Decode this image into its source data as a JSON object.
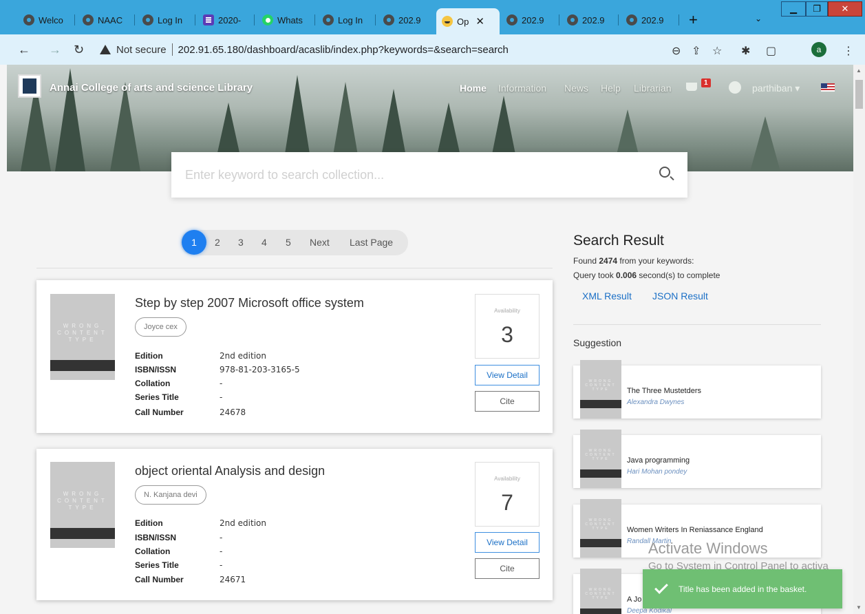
{
  "browser": {
    "tabs": [
      {
        "label": "Welco",
        "icon": "globe-icon"
      },
      {
        "label": "NAAC",
        "icon": "globe-icon"
      },
      {
        "label": "Log In",
        "icon": "globe-icon"
      },
      {
        "label": "2020-",
        "icon": "forms-icon"
      },
      {
        "label": "Whats",
        "icon": "whatsapp-icon"
      },
      {
        "label": "Log In",
        "icon": "globe-icon"
      },
      {
        "label": "202.9",
        "icon": "globe-icon"
      },
      {
        "label": "Op",
        "icon": "smile-icon",
        "active": true
      },
      {
        "label": "202.9",
        "icon": "globe-icon"
      },
      {
        "label": "202.9",
        "icon": "globe-icon"
      },
      {
        "label": "202.9",
        "icon": "globe-icon"
      }
    ],
    "new_tab": "+",
    "not_secure": "Not secure",
    "url": "202.91.65.180/dashboard/acaslib/index.php?keywords=&search=search",
    "profile_letter": "a"
  },
  "site": {
    "brand": "Annai College of arts and science Library",
    "nav": [
      "Home",
      "Information",
      "News",
      "Help",
      "Librarian"
    ],
    "basket_count": "1",
    "user": "parthiban ▾"
  },
  "search": {
    "placeholder": "Enter keyword to search collection..."
  },
  "pagination": {
    "pages": [
      "1",
      "2",
      "3",
      "4",
      "5"
    ],
    "next": "Next",
    "last": "Last Page"
  },
  "results": [
    {
      "title": "Step by step 2007 Microsoft office system",
      "author": "Joyce cex",
      "meta": [
        {
          "key": "Edition",
          "value": "2nd edition"
        },
        {
          "key": "ISBN/ISSN",
          "value": "978-81-203-3165-5"
        },
        {
          "key": "Collation",
          "value": "-"
        },
        {
          "key": "Series Title",
          "value": "-"
        },
        {
          "key": "Call Number",
          "value": "24678"
        }
      ],
      "availability_label": "Availability",
      "availability": "3",
      "view_detail": "View Detail",
      "cite": "Cite"
    },
    {
      "title": "object oriental Analysis and design",
      "author": "N. Kanjana devi",
      "meta": [
        {
          "key": "Edition",
          "value": "2nd edition"
        },
        {
          "key": "ISBN/ISSN",
          "value": "-"
        },
        {
          "key": "Collation",
          "value": "-"
        },
        {
          "key": "Series Title",
          "value": "-"
        },
        {
          "key": "Call Number",
          "value": "24671"
        }
      ],
      "availability_label": "Availability",
      "availability": "7",
      "view_detail": "View Detail",
      "cite": "Cite"
    }
  ],
  "cover_placeholder": "WRONG CONTENT TYPE",
  "sidebar": {
    "title": "Search Result",
    "found_prefix": "Found ",
    "found_count": "2474",
    "found_suffix": " from your keywords:",
    "query_prefix": "Query took ",
    "query_time": "0.006",
    "query_suffix": " second(s) to complete",
    "xml_link": "XML Result",
    "json_link": "JSON Result",
    "suggestion_title": "Suggestion",
    "suggestions": [
      {
        "title": "The Three Mustetders",
        "author": "Alexandra Dwynes"
      },
      {
        "title": "Java programming",
        "author": "Hari Mohan pondey"
      },
      {
        "title": "Women Writers In Reniassance England",
        "author": "Randall Martin"
      },
      {
        "title": "A Jo",
        "author": "Deepa Kodikal"
      }
    ]
  },
  "watermark": {
    "line1": "Activate Windows",
    "line2": "Go to System in Control Panel to activa"
  },
  "toast": {
    "message": "Title has been added in the basket."
  }
}
